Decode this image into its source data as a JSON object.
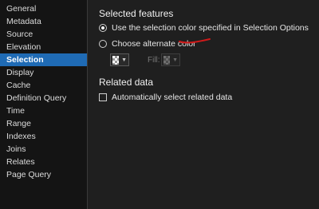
{
  "sidebar": {
    "items": [
      {
        "label": "General"
      },
      {
        "label": "Metadata"
      },
      {
        "label": "Source"
      },
      {
        "label": "Elevation"
      },
      {
        "label": "Selection"
      },
      {
        "label": "Display"
      },
      {
        "label": "Cache"
      },
      {
        "label": "Definition Query"
      },
      {
        "label": "Time"
      },
      {
        "label": "Range"
      },
      {
        "label": "Indexes"
      },
      {
        "label": "Joins"
      },
      {
        "label": "Relates"
      },
      {
        "label": "Page Query"
      }
    ],
    "active_label": "Selection"
  },
  "selected_features": {
    "title": "Selected features",
    "option_default": "Use the selection color specified in Selection Options",
    "option_alternate": "Choose alternate color",
    "selected_option": "default",
    "fill_label": "Fill:"
  },
  "related_data": {
    "title": "Related data",
    "auto_select_label": "Automatically select related data",
    "auto_select_checked": false
  },
  "colors": {
    "accent": "#1f6bb5",
    "annotation": "#d11a1a",
    "background": "#1f1f1f"
  }
}
